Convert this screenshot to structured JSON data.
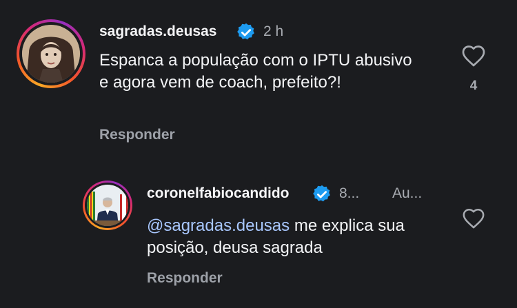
{
  "comments": [
    {
      "username": "sagradas.deusas",
      "time": "2 h",
      "text": "Espanca a população com o IPTU abusivo e agora vem de coach, prefeito?!",
      "reply_label": "Responder",
      "likes": "4"
    },
    {
      "username": "coronelfabiocandido",
      "time": "8...",
      "author_badge": "Au...",
      "mention": "@sagradas.deusas",
      "text": " me explica sua posição, deusa sagrada",
      "reply_label": "Responder"
    }
  ],
  "colors": {
    "background": "#1b1c1f",
    "verified": "#1d9bf0",
    "mention": "#a9c8ff"
  }
}
